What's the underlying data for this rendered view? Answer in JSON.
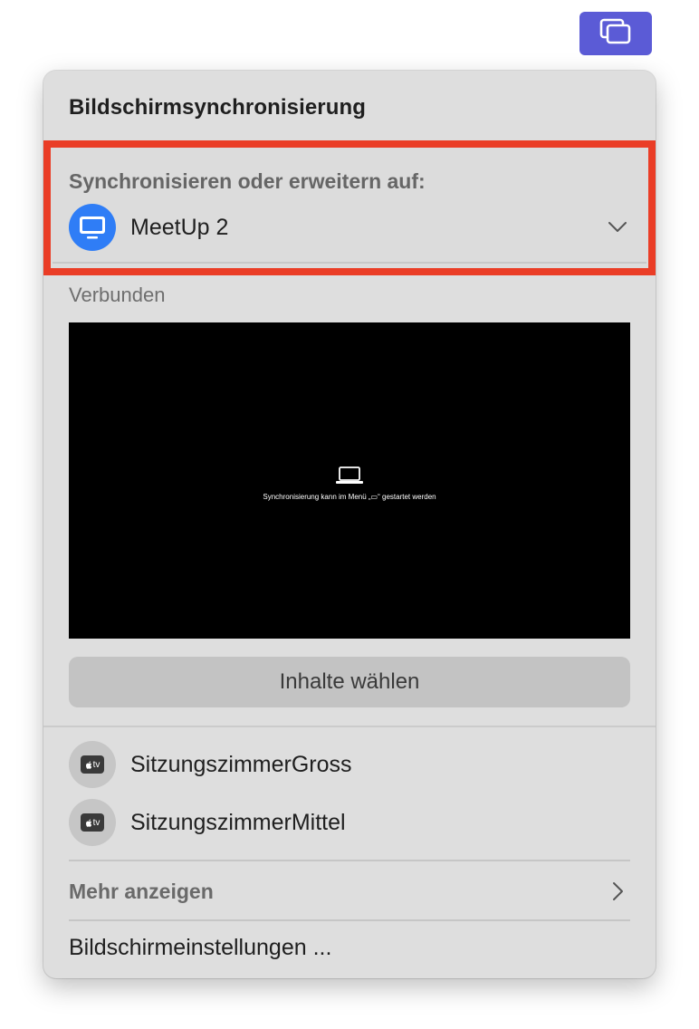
{
  "menubar": {
    "icon": "screen-mirroring-icon",
    "accent_color": "#5b5bd6"
  },
  "panel": {
    "title": "Bildschirmsynchronisierung",
    "mirror_section": {
      "header": "Synchronisieren oder erweitern auf:",
      "device_name": "MeetUp 2",
      "device_icon": "display-icon",
      "highlight_color": "#ea3d26"
    },
    "connected_label": "Verbunden",
    "preview": {
      "text": "Synchronisierung kann im Menü „▭“ gestartet werden",
      "icon": "laptop-icon"
    },
    "choose_button_label": "Inhalte wählen",
    "devices": [
      {
        "name": "SitzungszimmerGross",
        "icon": "apple-tv-icon",
        "badge": "tv"
      },
      {
        "name": "SitzungszimmerMittel",
        "icon": "apple-tv-icon",
        "badge": "tv"
      }
    ],
    "more_label": "Mehr anzeigen",
    "settings_label": "Bildschirmeinstellungen ..."
  }
}
